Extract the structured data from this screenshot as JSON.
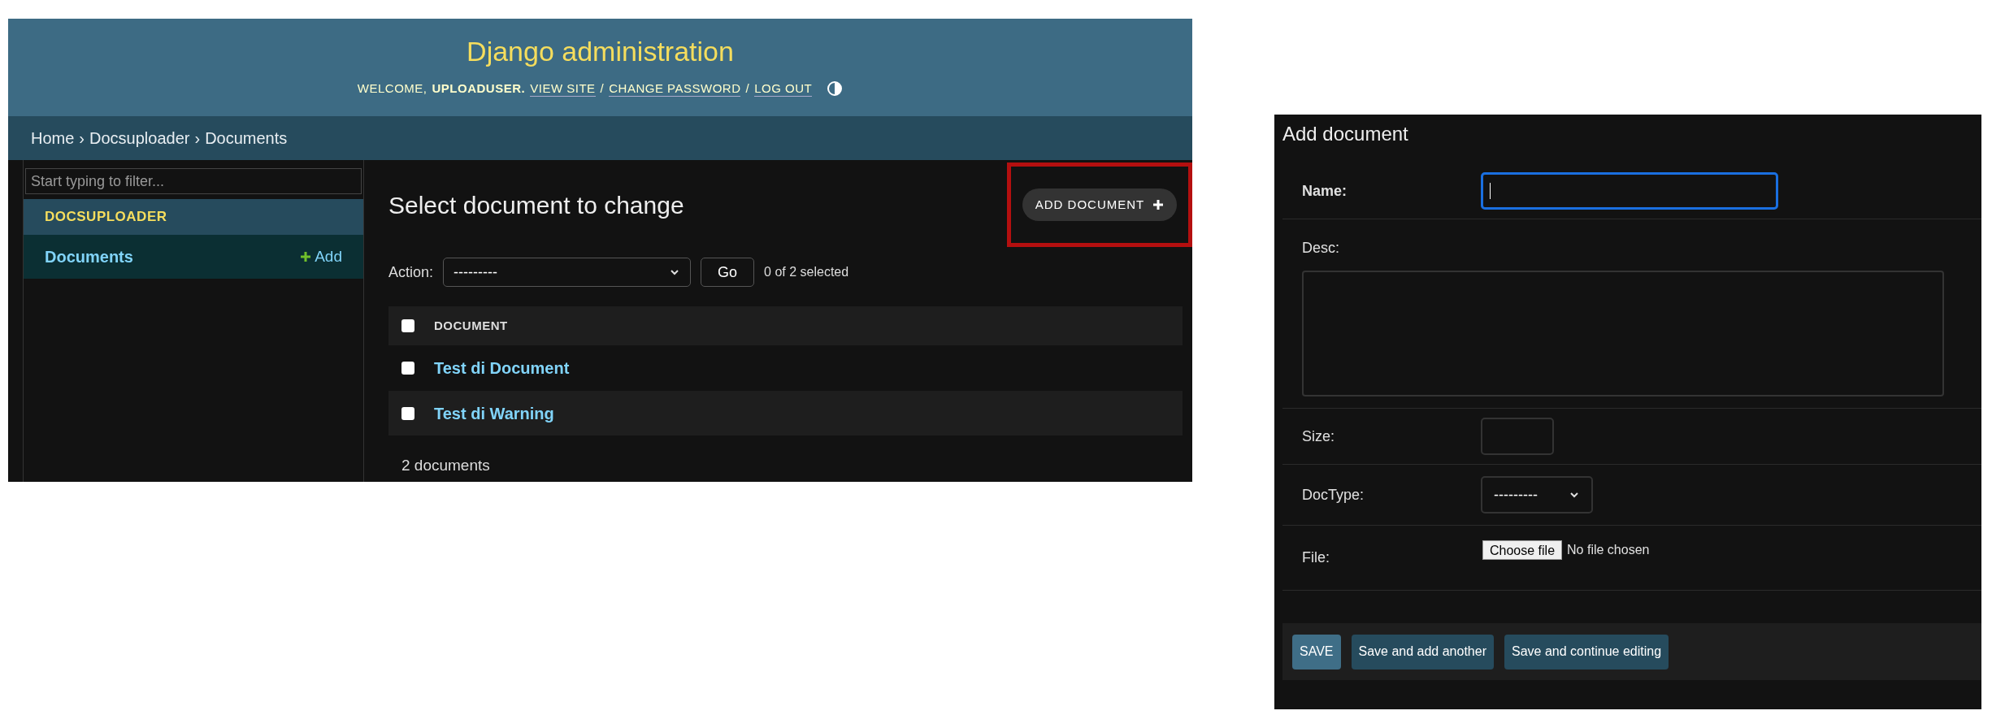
{
  "list_page": {
    "header": {
      "title": "Django administration",
      "welcome": "WELCOME,",
      "user": "UPLOADUSER.",
      "links": [
        "VIEW SITE",
        "CHANGE PASSWORD",
        "LOG OUT"
      ],
      "separators": [
        "/",
        "/"
      ]
    },
    "breadcrumbs": [
      "Home",
      "›",
      "Docsuploader",
      "›",
      "Documents"
    ],
    "sidebar": {
      "filter_placeholder": "Start typing to filter...",
      "app": "DOCSUPLOADER",
      "models": [
        {
          "name": "Documents",
          "add": "Add",
          "selected": true
        }
      ]
    },
    "title": "Select document to change",
    "add_button": {
      "label": "ADD DOCUMENT",
      "highlighted": true
    },
    "actions": {
      "label": "Action:",
      "value": "---------",
      "go": "Go",
      "counter": "0 of 2 selected"
    },
    "table": {
      "header_checked": false,
      "column": "DOCUMENT",
      "rows": [
        {
          "name": "Test di Document",
          "checked": false
        },
        {
          "name": "Test di Warning",
          "checked": false
        }
      ]
    },
    "footer": "2 documents"
  },
  "add_form": {
    "title": "Add document",
    "fields": [
      {
        "kind": "text",
        "label": "Name:",
        "required": true,
        "focused": true
      },
      {
        "kind": "textarea",
        "label": "Desc:",
        "required": false,
        "focused": false
      },
      {
        "kind": "small",
        "label": "Size:",
        "required": false,
        "focused": false
      },
      {
        "kind": "select",
        "label": "DocType:",
        "required": false,
        "value": "---------",
        "focused": false
      },
      {
        "kind": "file",
        "label": "File:",
        "required": false,
        "button": "Choose file",
        "status": "No file chosen",
        "focused": false
      }
    ],
    "buttons": [
      {
        "label": "SAVE",
        "kind": "default"
      },
      {
        "label": "Save and add another",
        "kind": "secondary"
      },
      {
        "label": "Save and continue editing",
        "kind": "secondary"
      }
    ]
  }
}
